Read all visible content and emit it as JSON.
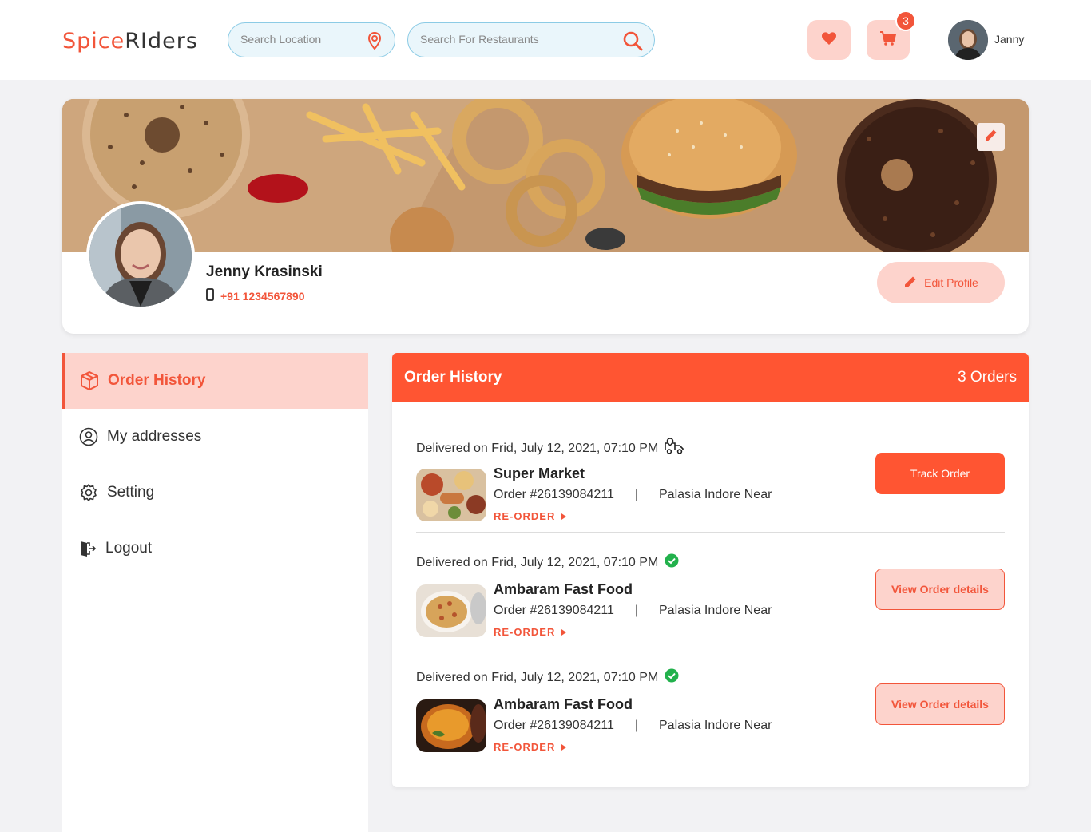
{
  "brand": {
    "part1": "Spice",
    "part2": "RIders",
    "accent": "#f2553a"
  },
  "header": {
    "location_placeholder": "Search Location",
    "restaurant_placeholder": "Search For Restaurants",
    "cart_count": "3",
    "user_name": "Janny",
    "icons": [
      "location-pin-icon",
      "search-icon",
      "heart-icon",
      "cart-icon"
    ]
  },
  "profile": {
    "name": "Jenny Krasinski",
    "phone": "+91 1234567890",
    "edit_label": "Edit Profile"
  },
  "sidebar": {
    "items": [
      {
        "label": "Order History",
        "icon": "box-icon",
        "active": true
      },
      {
        "label": "My addresses",
        "icon": "user-location-icon",
        "active": false
      },
      {
        "label": "Setting",
        "icon": "gear-icon",
        "active": false
      },
      {
        "label": "Logout",
        "icon": "logout-icon",
        "active": false
      }
    ]
  },
  "orders_panel": {
    "title": "Order History",
    "count": "3 Orders",
    "orders": [
      {
        "delivered": "Delivered on Frid, July 12, 2021, 07:10 PM",
        "status_icon": "delivery-truck-icon",
        "name": "Super Market",
        "number": "Order #26139084211",
        "separator": "|",
        "address": "Palasia Indore Near",
        "reorder": "RE-ORDER",
        "action": "Track Order"
      },
      {
        "delivered": "Delivered on Frid, July 12, 2021, 07:10 PM",
        "status_icon": "check-circle-icon",
        "name": "Ambaram Fast Food",
        "number": "Order #26139084211",
        "separator": "|",
        "address": "Palasia Indore Near",
        "reorder": "RE-ORDER",
        "action": "View Order details"
      },
      {
        "delivered": "Delivered on Frid, July 12, 2021, 07:10 PM",
        "status_icon": "check-circle-icon",
        "name": "Ambaram Fast Food",
        "number": "Order #26139084211",
        "separator": "|",
        "address": "Palasia Indore Near",
        "reorder": "RE-ORDER",
        "action": "View Order details"
      }
    ]
  }
}
